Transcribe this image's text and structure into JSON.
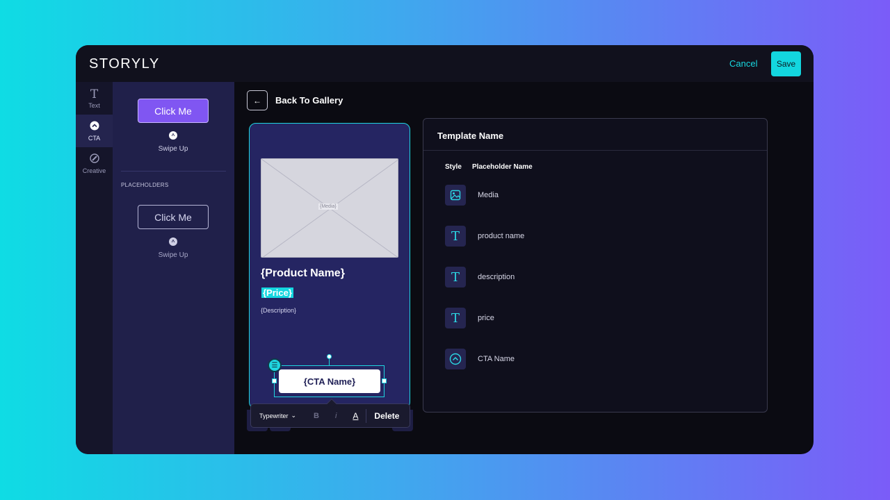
{
  "brand": {
    "logo_text": "STORYLY"
  },
  "header": {
    "cancel_label": "Cancel",
    "save_label": "Save"
  },
  "rail": {
    "items": [
      {
        "label": "Text",
        "icon": "text-icon"
      },
      {
        "label": "CTA",
        "icon": "cta-icon"
      },
      {
        "label": "Creative",
        "icon": "creative-icon"
      }
    ]
  },
  "panel": {
    "cta_button_label": "Click Me",
    "swipe_label": "Swipe Up",
    "placeholders_heading": "PLACEHOLDERS",
    "ph_button_label": "Click Me",
    "ph_swipe_label": "Swipe Up"
  },
  "editor": {
    "back_label": "Back To Gallery",
    "media_tag": "{Media}",
    "product_name": "{Product Name}",
    "price": "{Price}",
    "description": "{Description}",
    "cta_name": "{CTA Name}"
  },
  "toolbar": {
    "font_value": "Typewriter",
    "bold_label": "B",
    "italic_label": "i",
    "color_label": "A",
    "delete_label": "Delete"
  },
  "template": {
    "title": "Template Name",
    "col_style": "Style",
    "col_name": "Placeholder Name",
    "rows": [
      {
        "name": "Media",
        "icon": "image-icon"
      },
      {
        "name": "product name",
        "icon": "text-icon"
      },
      {
        "name": "description",
        "icon": "text-icon"
      },
      {
        "name": "price",
        "icon": "text-icon"
      },
      {
        "name": "CTA Name",
        "icon": "cta-icon"
      }
    ]
  },
  "colors": {
    "accent": "#13d6df",
    "purple": "#8056f2",
    "story_bg": "#252562"
  }
}
